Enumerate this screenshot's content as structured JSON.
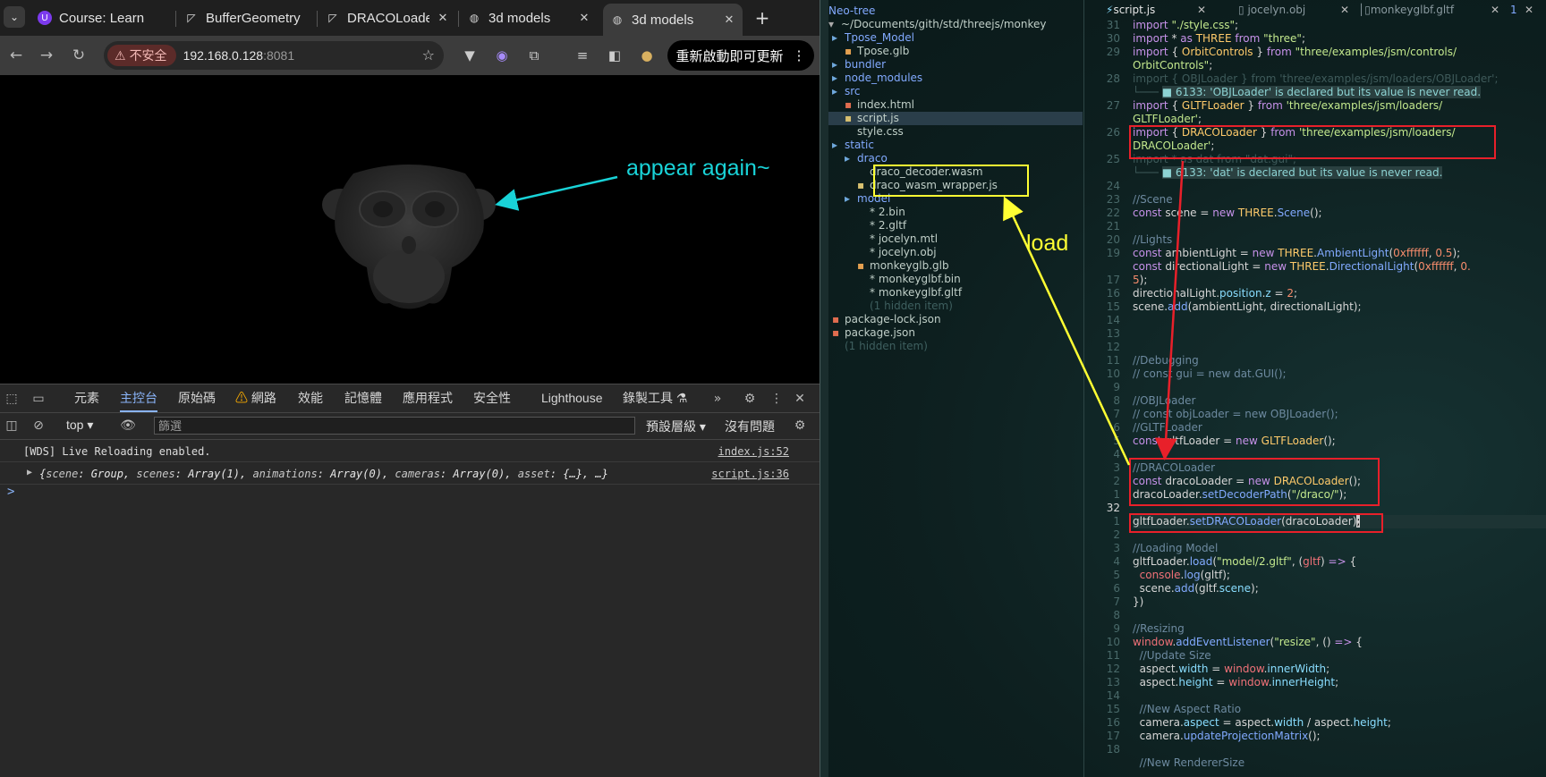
{
  "browser": {
    "tabs": [
      {
        "title": "Course: Learn",
        "icon": "course-icon"
      },
      {
        "title": "BufferGeometry",
        "icon": "threejs-icon"
      },
      {
        "title": "DRACOLoader",
        "icon": "threejs-icon"
      },
      {
        "title": "3d models",
        "icon": "globe-icon"
      },
      {
        "title": "3d models",
        "icon": "globe-icon",
        "active": true
      }
    ],
    "new_tab": "+",
    "omnibox": {
      "security_label": "不安全",
      "host": "192.168.0.128",
      "port": ":8081"
    },
    "update_button": "重新啟動即可更新"
  },
  "viewport": {
    "annotation": "appear again~"
  },
  "devtools": {
    "tabs": [
      "元素",
      "主控台",
      "原始碼",
      "網路",
      "效能",
      "記憶體",
      "應用程式",
      "安全性",
      "Lighthouse",
      "錄製工具"
    ],
    "active_tab": "主控台",
    "context": "top",
    "filter_placeholder": "篩選",
    "levels": "預設層級",
    "issues": "沒有問題",
    "console": [
      {
        "message": "[WDS] Live Reloading enabled.",
        "source": "index.js:52"
      },
      {
        "message_parts": [
          "{",
          "scene",
          ": Group, ",
          "scenes",
          ": Array(1), ",
          "animations",
          ": Array(0), ",
          "cameras",
          ": Array(0), ",
          "asset",
          ": {…}, …}"
        ],
        "source": "script.js:36"
      }
    ],
    "prompt": ">"
  },
  "tree": {
    "header": "Neo-tree",
    "path": "~/Documents/gith/std/threejs/monkey",
    "items": [
      {
        "name": "Tpose_Model",
        "type": "dir",
        "indent": 0
      },
      {
        "name": "Tpose.glb",
        "type": "file",
        "indent": 1
      },
      {
        "name": "bundler",
        "type": "dir",
        "indent": 0
      },
      {
        "name": "node_modules",
        "type": "dir",
        "indent": 0
      },
      {
        "name": "src",
        "type": "dir",
        "indent": 0
      },
      {
        "name": "index.html",
        "type": "file",
        "indent": 1
      },
      {
        "name": "script.js",
        "type": "file",
        "indent": 1,
        "selected": true
      },
      {
        "name": "style.css",
        "type": "file",
        "indent": 1
      },
      {
        "name": "static",
        "type": "dir",
        "indent": 0
      },
      {
        "name": "draco",
        "type": "dir",
        "indent": 1
      },
      {
        "name": "draco_decoder.wasm",
        "type": "file",
        "indent": 2
      },
      {
        "name": "draco_wasm_wrapper.js",
        "type": "file",
        "indent": 2
      },
      {
        "name": "model",
        "type": "dir",
        "indent": 1
      },
      {
        "name": "* 2.bin",
        "type": "file",
        "indent": 2
      },
      {
        "name": "* 2.gltf",
        "type": "file",
        "indent": 2
      },
      {
        "name": "* jocelyn.mtl",
        "type": "file",
        "indent": 2
      },
      {
        "name": "* jocelyn.obj",
        "type": "file",
        "indent": 2
      },
      {
        "name": "monkeyglb.glb",
        "type": "file",
        "indent": 2
      },
      {
        "name": "* monkeyglbf.bin",
        "type": "file",
        "indent": 2
      },
      {
        "name": "* monkeyglbf.gltf",
        "type": "file",
        "indent": 2
      },
      {
        "name": "(1 hidden item)",
        "type": "hidden",
        "indent": 2
      },
      {
        "name": "package-lock.json",
        "type": "file",
        "indent": 0
      },
      {
        "name": "package.json",
        "type": "file",
        "indent": 0
      },
      {
        "name": "(1 hidden item)",
        "type": "hidden",
        "indent": 0
      }
    ],
    "annotation": "load"
  },
  "editor": {
    "buffers": [
      "script.js",
      "jocelyn.obj",
      "monkeyglbf.gltf",
      "1"
    ],
    "gutter": [
      "31",
      "30",
      "29",
      "",
      "28",
      "",
      "27",
      "",
      "26",
      "",
      "25",
      "",
      "24",
      "23",
      "22",
      "21",
      "20",
      "19",
      "",
      "17",
      "16",
      "15",
      "14",
      "13",
      "12",
      "11",
      "10",
      "9",
      "8",
      "7",
      "6",
      "5",
      "4",
      "3",
      "2",
      "1",
      "32",
      "1",
      "2",
      "3",
      "4",
      "5",
      "6",
      "7",
      "8",
      "9",
      "10",
      "11",
      "12",
      "13",
      "14",
      "15",
      "16",
      "17",
      "18"
    ],
    "current_line_number": "32"
  },
  "colors": {
    "cyan_annotation": "#19d3d8",
    "yellow_annotation": "#ffff33",
    "red_box": "#e8202a"
  }
}
